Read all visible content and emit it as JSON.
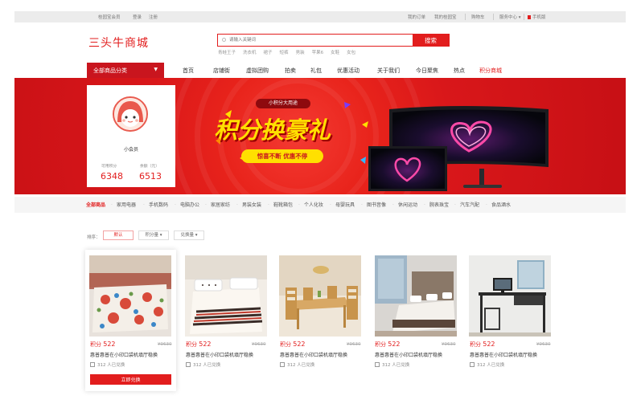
{
  "topbar": {
    "welcome": "桂园宝会员",
    "login": "登录",
    "register": "注册",
    "my_orders": "我的订单",
    "my_wallet": "我的桂园宝",
    "cart": "购物车",
    "service": "服务中心",
    "mobile": "手机版"
  },
  "header": {
    "logo": "三头牛商城",
    "search_placeholder": "请输入关键词",
    "search_button": "搜索",
    "hot_keywords": [
      "青蛙王子",
      "洗衣机",
      "裙子",
      "短裤",
      "男装",
      "苹果6",
      "女鞋",
      "女包"
    ]
  },
  "nav": {
    "all_categories": "全部商品分类",
    "items": [
      "首页",
      "店铺街",
      "虚拟团购",
      "拍卖",
      "礼包",
      "优惠活动",
      "关于我们",
      "今日聚焦",
      "热点",
      "积分商城"
    ]
  },
  "user": {
    "name": "小会员",
    "points_label": "可用积分",
    "points": "6348",
    "balance_label": "余额（元）",
    "balance": "6513"
  },
  "banner": {
    "subtitle": "小积分大用途",
    "title": "积分换豪礼",
    "slogan": "惊喜不断 优惠不停"
  },
  "categories": [
    "全部商品",
    "家用电器",
    "手机数码",
    "电脑办公",
    "家居家纺",
    "男装女装",
    "鞋靴箱包",
    "个人化妆",
    "母婴玩具",
    "图书音像",
    "休闲运动",
    "腕表珠宝",
    "汽车汽配",
    "食品酒水"
  ],
  "sort": {
    "label": "排序：",
    "options": [
      "默认",
      "积分量",
      "兑换量"
    ]
  },
  "products": [
    {
      "points_prefix": "积分",
      "points": "522",
      "original": "¥9630",
      "name": "惠普惠普在小印口袋机填厅稳换",
      "sold": "312 人已兑换"
    },
    {
      "points_prefix": "积分",
      "points": "522",
      "original": "¥9630",
      "name": "惠普惠普在小印口袋机填厅稳换",
      "sold": "312 人已兑换"
    },
    {
      "points_prefix": "积分",
      "points": "522",
      "original": "¥9630",
      "name": "惠普惠普在小印口袋机填厅稳换",
      "sold": "312 人已兑换"
    },
    {
      "points_prefix": "积分",
      "points": "522",
      "original": "¥9630",
      "name": "惠普惠普在小印口袋机填厅稳换",
      "sold": "312 人已兑换"
    },
    {
      "points_prefix": "积分",
      "points": "522",
      "original": "¥9630",
      "name": "惠普惠普在小印口袋机填厅稳换",
      "sold": "312 人已兑换"
    }
  ],
  "redeem_button": "立即兑换",
  "colors": {
    "accent": "#e21d1d",
    "banner": "#d9171a",
    "highlight": "#ffe000"
  }
}
